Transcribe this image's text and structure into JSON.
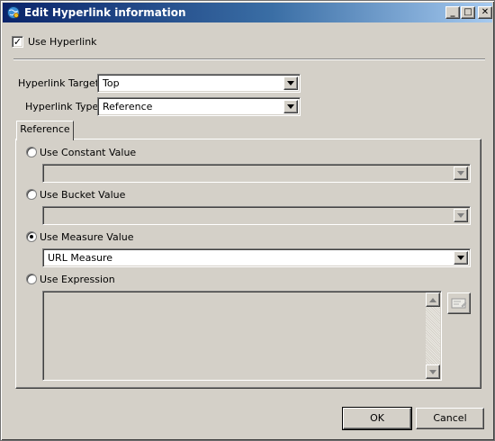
{
  "window": {
    "title": "Edit Hyperlink information",
    "controls": {
      "minimize": "_",
      "maximize": "□",
      "close": "✕"
    }
  },
  "use_hyperlink": {
    "label": "Use Hyperlink",
    "checked": true
  },
  "hyperlink_target": {
    "label": "Hyperlink Target",
    "value": "Top"
  },
  "hyperlink_type": {
    "label": "Hyperlink Type",
    "value": "Reference"
  },
  "tab": {
    "label": "Reference"
  },
  "options": {
    "constant": {
      "label": "Use Constant Value",
      "selected": false,
      "value": ""
    },
    "bucket": {
      "label": "Use Bucket Value",
      "selected": false,
      "value": ""
    },
    "measure": {
      "label": "Use Measure Value",
      "selected": true,
      "value": "URL Measure"
    },
    "expression": {
      "label": "Use Expression",
      "selected": false,
      "value": ""
    }
  },
  "buttons": {
    "ok": "OK",
    "cancel": "Cancel"
  },
  "icons": {
    "app": "hyperlink-globe-icon",
    "edit_expression": "expression-editor-icon",
    "dropdown": "chevron-down-icon"
  },
  "colors": {
    "titlebar_start": "#0a246a",
    "titlebar_end": "#a6caf0",
    "face": "#d4d0c8"
  }
}
